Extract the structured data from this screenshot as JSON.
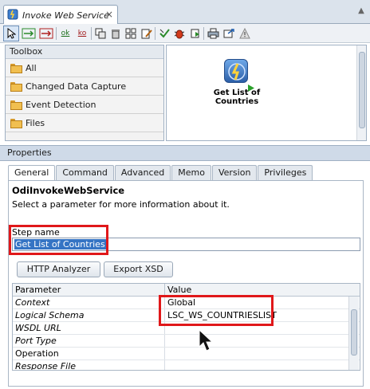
{
  "window": {
    "tab_title": "Invoke Web Service",
    "close_glyph": "×",
    "scroll_glyph": "▲"
  },
  "toolbar": {
    "items": [
      "select-tool-icon",
      "ok-link-icon",
      "ko-link-icon",
      "ok-text-icon",
      "ko-text-icon",
      "duplicate-icon",
      "delete-icon",
      "layout-icon",
      "edit-icon",
      "validate-icon",
      "debug-bug-icon",
      "run-icon",
      "print-icon",
      "export-icon",
      "warning-icon"
    ],
    "ok_label": "ok",
    "ko_label": "ko"
  },
  "toolbox": {
    "title": "Toolbox",
    "items": [
      "All",
      "Changed Data Capture",
      "Event Detection",
      "Files"
    ]
  },
  "diagram": {
    "node_label": "Get List of Countries"
  },
  "properties": {
    "title": "Properties",
    "tabs": [
      "General",
      "Command",
      "Advanced",
      "Memo",
      "Version",
      "Privileges"
    ],
    "active_tab": "General",
    "object_title": "OdiInvokeWebService",
    "description": "Select a parameter for more information about it.",
    "step_name_label": "Step name",
    "step_name_value": "Get List of Countries",
    "http_analyzer_label": "HTTP Analyzer",
    "export_xsd_label": "Export XSD",
    "grid": {
      "headers": [
        "Parameter",
        "Value"
      ],
      "rows": [
        [
          "Context",
          "Global"
        ],
        [
          "Logical Schema",
          "LSC_WS_COUNTRIESLIST"
        ],
        [
          "WSDL URL",
          ""
        ],
        [
          "Port Type",
          ""
        ],
        [
          "Operation",
          ""
        ],
        [
          "Response File",
          ""
        ]
      ]
    }
  },
  "colors": {
    "highlight": "#e0181a",
    "selection": "#3574c4",
    "panel_header": "#cfdae8"
  }
}
